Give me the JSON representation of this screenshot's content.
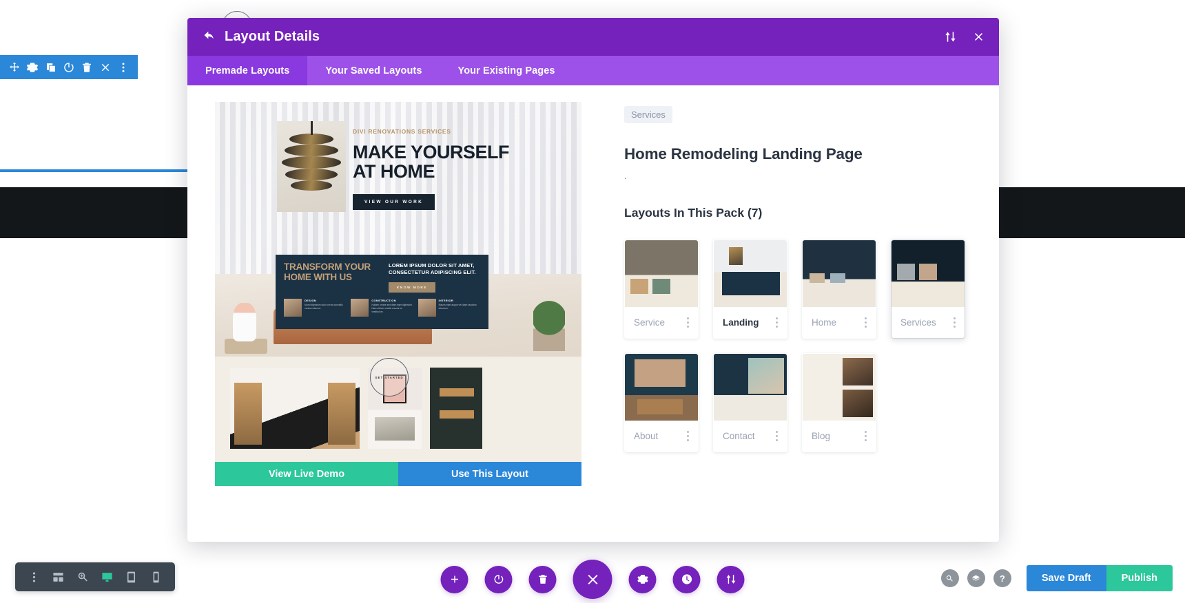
{
  "element_toolbar": {
    "icons": [
      "move-icon",
      "gear-icon",
      "duplicate-icon",
      "power-icon",
      "trash-icon",
      "close-icon",
      "more-options-icon"
    ]
  },
  "modal": {
    "title": "Layout Details",
    "back_icon": "back-arrow-icon",
    "sort_icon": "sort-icon",
    "close_icon": "close-icon",
    "tabs": [
      {
        "label": "Premade Layouts",
        "active": true
      },
      {
        "label": "Your Saved Layouts",
        "active": false
      },
      {
        "label": "Your Existing Pages",
        "active": false
      }
    ]
  },
  "preview": {
    "hero": {
      "kicker": "DIVI RENOVATIONS SERVICES",
      "heading_line1": "MAKE YOURSELF",
      "heading_line2": "AT HOME",
      "button": "VIEW OUR WORK"
    },
    "promo": {
      "heading_line1": "TRANSFORM YOUR",
      "heading_line2": "HOME WITH US",
      "subheading_line1": "LOREM IPSUM DOLOR SIT AMET,",
      "subheading_line2": "CONSECTETUR ADIPISCING ELIT.",
      "button": "KNOW MORE",
      "columns": [
        {
          "title": "DESIGN",
          "text": "Morbi dignissim dolor a erat convallis varius euismod."
        },
        {
          "title": "CONSTRUCTION",
          "text": "Nullam ornare sed diam eget dignissim. Nam ultrices mattis mauris eu vestibulum."
        },
        {
          "title": "INTERIOR",
          "text": "Mauris eget augue vel diam faucibus interdum."
        }
      ]
    },
    "gallery_badge": "GET STARTED",
    "actions": {
      "demo_label": "View Live Demo",
      "use_label": "Use This Layout",
      "demo_color": "#2cc79b",
      "use_color": "#2b87d8"
    }
  },
  "details": {
    "category": "Services",
    "pack_title": "Home Remodeling Landing Page",
    "pack_description": ".",
    "layouts_heading": "Layouts In This Pack (7)",
    "layouts": [
      {
        "name": "Service",
        "selected": false,
        "hovered": false,
        "art": "t-service"
      },
      {
        "name": "Landing",
        "selected": true,
        "hovered": false,
        "art": "t-landing"
      },
      {
        "name": "Home",
        "selected": false,
        "hovered": false,
        "art": "t-home"
      },
      {
        "name": "Services",
        "selected": false,
        "hovered": true,
        "art": "t-services"
      },
      {
        "name": "About",
        "selected": false,
        "hovered": false,
        "art": "t-about"
      },
      {
        "name": "Contact",
        "selected": false,
        "hovered": false,
        "art": "t-contact"
      },
      {
        "name": "Blog",
        "selected": false,
        "hovered": false,
        "art": "t-blog"
      }
    ]
  },
  "device_bar": {
    "icons": [
      "more-options-icon",
      "wireframe-icon",
      "zoom-icon",
      "desktop-icon",
      "tablet-icon",
      "phone-icon"
    ],
    "active": "desktop-icon",
    "active_color": "#2cc79b"
  },
  "bottom_bar": {
    "center_icons": [
      "add-icon",
      "power-icon",
      "trash-icon",
      "close-icon",
      "gear-icon",
      "history-icon",
      "sort-icon"
    ],
    "right_icons": [
      "search-icon",
      "layers-icon",
      "help-icon"
    ],
    "save_draft_label": "Save Draft",
    "publish_label": "Publish",
    "save_draft_color": "#2b87d8",
    "publish_color": "#2cc79b",
    "accent_color": "#7521bc"
  }
}
